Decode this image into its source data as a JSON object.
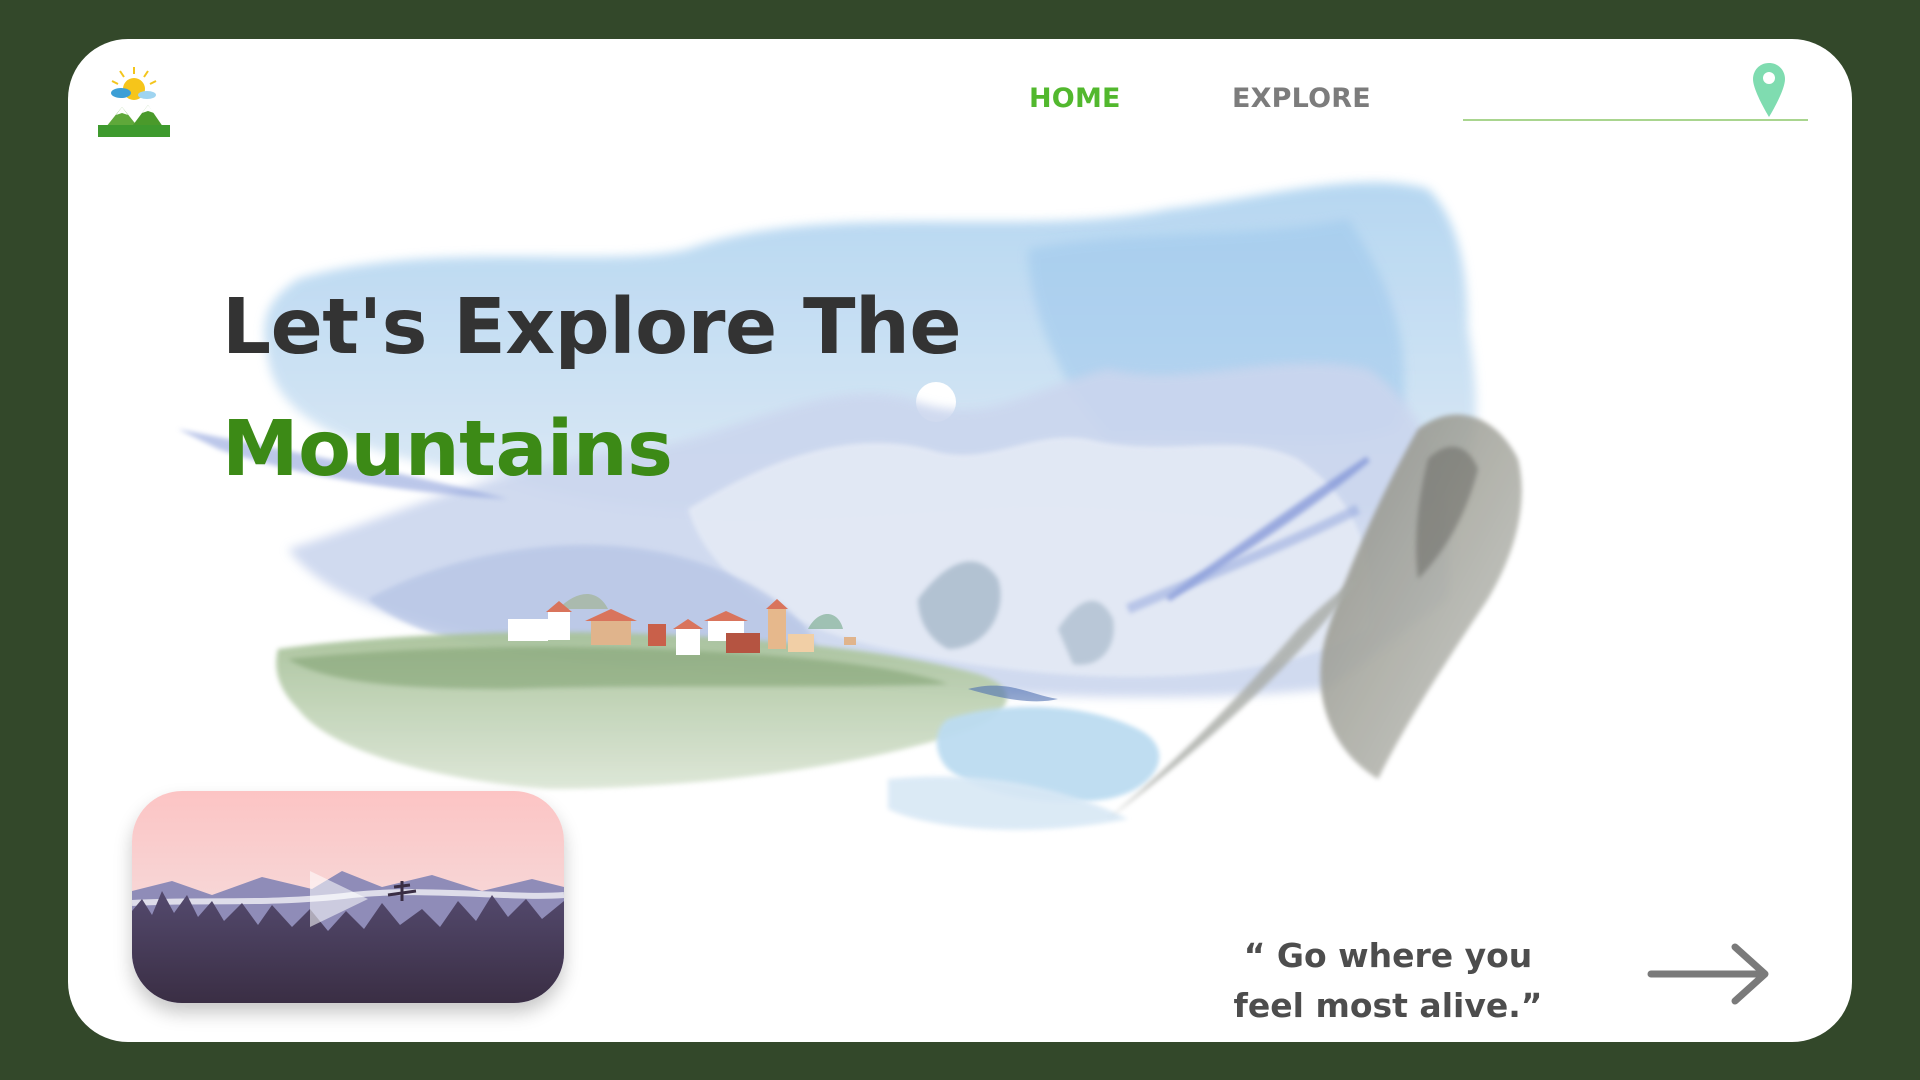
{
  "nav": {
    "home_label": "HOME",
    "explore_label": "EXPLORE",
    "search_placeholder": ""
  },
  "hero": {
    "line1": "Let's Explore The",
    "line2": "Mountains"
  },
  "quote": {
    "line1": "“ Go where you",
    "line2": "feel most alive.”"
  },
  "icons": {
    "logo": "sun-mountain-logo-icon",
    "location": "location-pin-icon",
    "play": "play-icon",
    "next": "arrow-right-icon"
  },
  "colors": {
    "frame": "#33482a",
    "accent_green": "#52b82e",
    "heading_dark": "#333333",
    "heading_green": "#3c8a16",
    "nav_gray": "#7c7c7c",
    "pin": "#7fdcb0"
  }
}
